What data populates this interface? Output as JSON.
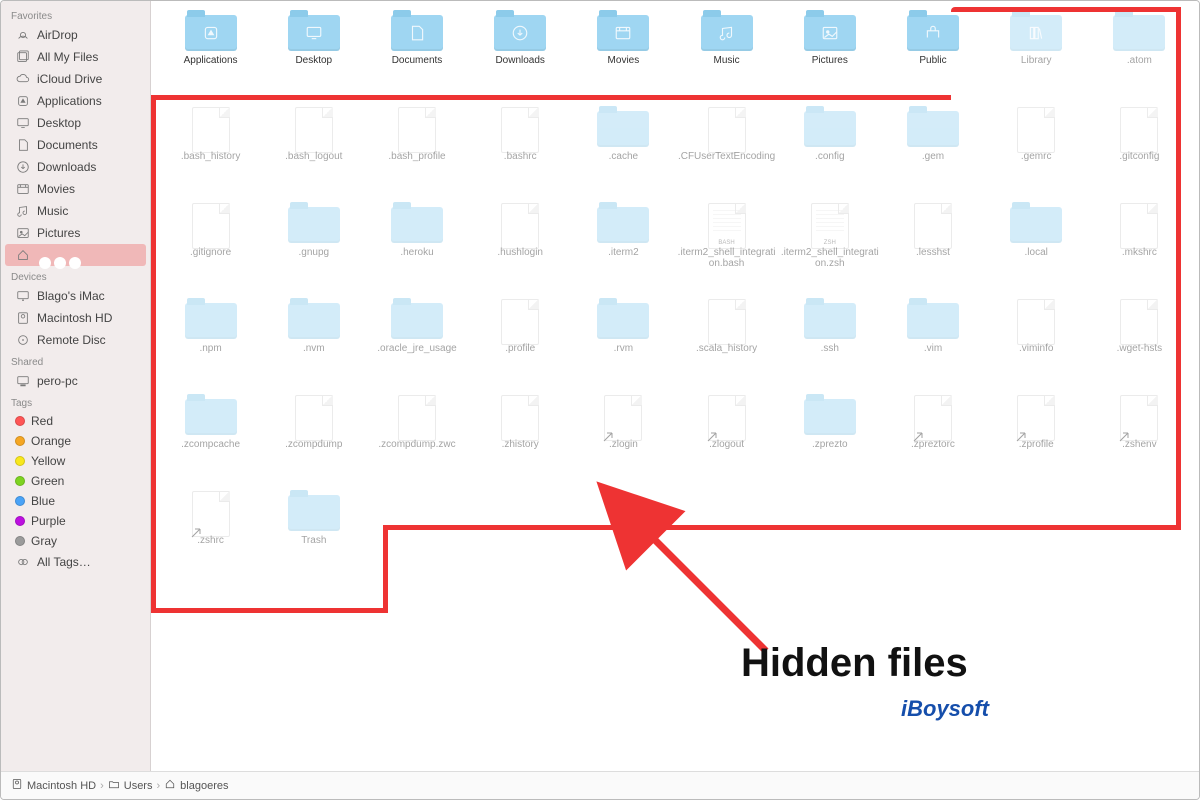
{
  "sidebar": {
    "sections": [
      {
        "header": "Favorites",
        "items": [
          {
            "icon": "airdrop",
            "label": "AirDrop"
          },
          {
            "icon": "allfiles",
            "label": "All My Files"
          },
          {
            "icon": "icloud",
            "label": "iCloud Drive"
          },
          {
            "icon": "apps",
            "label": "Applications"
          },
          {
            "icon": "desktop",
            "label": "Desktop"
          },
          {
            "icon": "documents",
            "label": "Documents"
          },
          {
            "icon": "downloads",
            "label": "Downloads"
          },
          {
            "icon": "movies",
            "label": "Movies"
          },
          {
            "icon": "music",
            "label": "Music"
          },
          {
            "icon": "pictures",
            "label": "Pictures"
          },
          {
            "icon": "home",
            "label": "",
            "selected": true
          }
        ]
      },
      {
        "header": "Devices",
        "items": [
          {
            "icon": "imac",
            "label": "Blago's iMac"
          },
          {
            "icon": "disk",
            "label": "Macintosh HD"
          },
          {
            "icon": "remotedisc",
            "label": "Remote Disc"
          }
        ]
      },
      {
        "header": "Shared",
        "items": [
          {
            "icon": "pc",
            "label": "pero-pc"
          }
        ]
      },
      {
        "header": "Tags",
        "items": [
          {
            "color": "#f55",
            "label": "Red"
          },
          {
            "color": "#f5a623",
            "label": "Orange"
          },
          {
            "color": "#f8e71c",
            "label": "Yellow"
          },
          {
            "color": "#7ed321",
            "label": "Green"
          },
          {
            "color": "#4aa3f7",
            "label": "Blue"
          },
          {
            "color": "#bd10e0",
            "label": "Purple"
          },
          {
            "color": "#9b9b9b",
            "label": "Gray"
          },
          {
            "icon": "alltags",
            "label": "All Tags…"
          }
        ]
      }
    ]
  },
  "grid": {
    "items": [
      {
        "type": "folder",
        "glyph": "apps",
        "label": "Applications",
        "hidden": false
      },
      {
        "type": "folder",
        "glyph": "desktop",
        "label": "Desktop",
        "hidden": false
      },
      {
        "type": "folder",
        "glyph": "documents",
        "label": "Documents",
        "hidden": false
      },
      {
        "type": "folder",
        "glyph": "downloads",
        "label": "Downloads",
        "hidden": false
      },
      {
        "type": "folder",
        "glyph": "movies",
        "label": "Movies",
        "hidden": false
      },
      {
        "type": "folder",
        "glyph": "music",
        "label": "Music",
        "hidden": false
      },
      {
        "type": "folder",
        "glyph": "pictures",
        "label": "Pictures",
        "hidden": false
      },
      {
        "type": "folder",
        "glyph": "public",
        "label": "Public",
        "hidden": false
      },
      {
        "type": "folder",
        "glyph": "library",
        "label": "Library",
        "hidden": true
      },
      {
        "type": "folder",
        "glyph": "",
        "label": ".atom",
        "hidden": true
      },
      {
        "type": "file",
        "label": ".bash_history",
        "hidden": true
      },
      {
        "type": "file",
        "label": ".bash_logout",
        "hidden": true
      },
      {
        "type": "file",
        "label": ".bash_profile",
        "hidden": true
      },
      {
        "type": "file",
        "label": ".bashrc",
        "hidden": true
      },
      {
        "type": "folder",
        "label": ".cache",
        "hidden": true
      },
      {
        "type": "file",
        "label": ".CFUserTextEncoding",
        "hidden": true
      },
      {
        "type": "folder",
        "label": ".config",
        "hidden": true
      },
      {
        "type": "folder",
        "label": ".gem",
        "hidden": true
      },
      {
        "type": "file",
        "label": ".gemrc",
        "hidden": true
      },
      {
        "type": "file",
        "label": ".gitconfig",
        "hidden": true
      },
      {
        "type": "file",
        "label": ".gitignore",
        "hidden": true
      },
      {
        "type": "folder",
        "label": ".gnupg",
        "hidden": true
      },
      {
        "type": "folder",
        "label": ".heroku",
        "hidden": true
      },
      {
        "type": "file",
        "label": ".hushlogin",
        "hidden": true
      },
      {
        "type": "folder",
        "label": ".iterm2",
        "hidden": true
      },
      {
        "type": "file",
        "label": ".iterm2_shell_integration.bash",
        "badge": "BASH",
        "hidden": true,
        "textish": true
      },
      {
        "type": "file",
        "label": ".iterm2_shell_integration.zsh",
        "badge": "ZSH",
        "hidden": true,
        "textish": true
      },
      {
        "type": "file",
        "label": ".lesshst",
        "hidden": true
      },
      {
        "type": "folder",
        "label": ".local",
        "hidden": true
      },
      {
        "type": "file",
        "label": ".mkshrc",
        "hidden": true
      },
      {
        "type": "folder",
        "label": ".npm",
        "hidden": true
      },
      {
        "type": "folder",
        "label": ".nvm",
        "hidden": true
      },
      {
        "type": "folder",
        "label": ".oracle_jre_usage",
        "hidden": true
      },
      {
        "type": "file",
        "label": ".profile",
        "hidden": true
      },
      {
        "type": "folder",
        "label": ".rvm",
        "hidden": true
      },
      {
        "type": "file",
        "label": ".scala_history",
        "hidden": true
      },
      {
        "type": "folder",
        "label": ".ssh",
        "hidden": true
      },
      {
        "type": "folder",
        "label": ".vim",
        "hidden": true
      },
      {
        "type": "file",
        "label": ".viminfo",
        "hidden": true
      },
      {
        "type": "file",
        "label": ".wget-hsts",
        "hidden": true
      },
      {
        "type": "folder",
        "label": ".zcompcache",
        "hidden": true
      },
      {
        "type": "file",
        "label": ".zcompdump",
        "hidden": true
      },
      {
        "type": "file",
        "label": ".zcompdump.zwc",
        "hidden": true
      },
      {
        "type": "file",
        "label": ".zhistory",
        "hidden": true
      },
      {
        "type": "file",
        "label": ".zlogin",
        "alias": true,
        "hidden": true
      },
      {
        "type": "file",
        "label": ".zlogout",
        "alias": true,
        "hidden": true
      },
      {
        "type": "folder",
        "label": ".zprezto",
        "hidden": true
      },
      {
        "type": "file",
        "label": ".zpreztorc",
        "alias": true,
        "hidden": true
      },
      {
        "type": "file",
        "label": ".zprofile",
        "alias": true,
        "hidden": true
      },
      {
        "type": "file",
        "label": ".zshenv",
        "alias": true,
        "hidden": true
      },
      {
        "type": "file",
        "label": ".zshrc",
        "alias": true,
        "hidden": true
      },
      {
        "type": "folder",
        "label": "Trash",
        "hidden": true
      }
    ]
  },
  "pathbar": {
    "segments": [
      {
        "icon": "disk",
        "label": "Macintosh HD"
      },
      {
        "icon": "folder",
        "label": "Users"
      },
      {
        "icon": "home",
        "label": "blagoeres"
      }
    ]
  },
  "annotation": {
    "caption": "Hidden files",
    "watermark": "iBoysoft"
  }
}
